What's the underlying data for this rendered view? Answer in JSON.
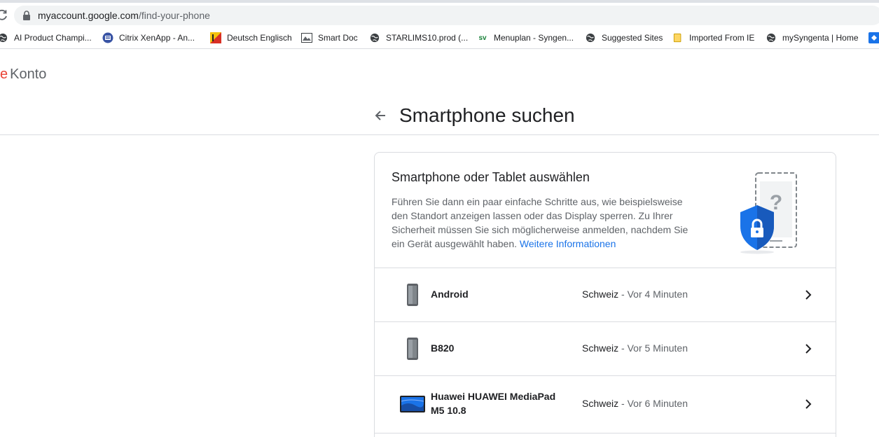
{
  "browser": {
    "url_host": "myaccount.google.com",
    "url_path": "/find-your-phone",
    "bookmarks": [
      {
        "label": "AI Product Champi...",
        "icon": "globe-icon"
      },
      {
        "label": "Citrix XenApp - An...",
        "icon": "citrix-icon"
      },
      {
        "label": "Deutsch Englisch",
        "icon": "dictionary-icon"
      },
      {
        "label": "Smart Doc",
        "icon": "document-icon"
      },
      {
        "label": "STARLIMS10.prod (...",
        "icon": "globe-icon"
      },
      {
        "label": "Menuplan - Syngen...",
        "icon": "sv-icon",
        "icon_text": "sv"
      },
      {
        "label": "Suggested Sites",
        "icon": "globe-icon"
      },
      {
        "label": "Imported From IE",
        "icon": "folder-icon"
      },
      {
        "label": "mySyngenta | Home",
        "icon": "globe-icon"
      }
    ]
  },
  "header": {
    "brand_fragment": "e",
    "brand_label": "Konto"
  },
  "page": {
    "title": "Smartphone suchen"
  },
  "card": {
    "title": "Smartphone oder Tablet auswählen",
    "description": "Führen Sie dann ein paar einfache Schritte aus, wie beispielsweise den Standort anzeigen lassen oder das Display sperren. Zu Ihrer Sicherheit müssen Sie sich möglicherweise anmelden, nachdem Sie ein Gerät ausgewählt haben.",
    "link_label": "Weitere Informationen",
    "devices": [
      {
        "name": "Android",
        "location": "Schweiz",
        "separator": " - ",
        "time": "Vor 4 Minuten",
        "icon": "phone-icon"
      },
      {
        "name": "B820",
        "location": "Schweiz",
        "separator": " - ",
        "time": "Vor 5 Minuten",
        "icon": "phone-icon"
      },
      {
        "name": "Huawei HUAWEI MediaPad M5 10.8",
        "location": "Schweiz",
        "separator": " - ",
        "time": "Vor 6 Minuten",
        "icon": "tablet-icon"
      }
    ]
  },
  "colors": {
    "accent": "#1a73e8",
    "shield": "#1a73e8",
    "brand_red": "#ea4335"
  }
}
